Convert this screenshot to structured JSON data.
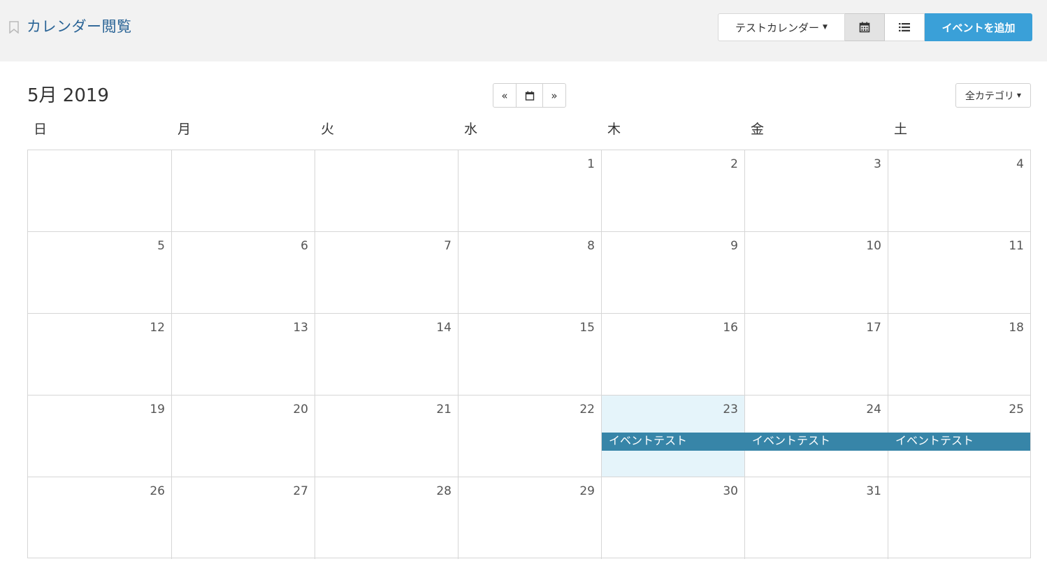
{
  "header": {
    "page_title": "カレンダー閲覧",
    "calendar_select_label": "テストカレンダー",
    "add_event_label": "イベントを追加"
  },
  "calendar": {
    "month_title": "5月 2019",
    "category_filter_label": "全カテゴリ",
    "nav": {
      "prev_label": "«",
      "next_label": "»"
    },
    "weekdays": [
      "日",
      "月",
      "火",
      "水",
      "木",
      "金",
      "土"
    ],
    "weeks": [
      [
        "",
        "",
        "",
        "1",
        "2",
        "3",
        "4"
      ],
      [
        "5",
        "6",
        "7",
        "8",
        "9",
        "10",
        "11"
      ],
      [
        "12",
        "13",
        "14",
        "15",
        "16",
        "17",
        "18"
      ],
      [
        "19",
        "20",
        "21",
        "22",
        "23",
        "24",
        "25"
      ],
      [
        "26",
        "27",
        "28",
        "29",
        "30",
        "31",
        ""
      ]
    ],
    "today": "23",
    "events": [
      {
        "title": "イベントテスト",
        "day": "23"
      },
      {
        "title": "イベントテスト",
        "day": "24"
      },
      {
        "title": "イベントテスト",
        "day": "25"
      }
    ]
  },
  "colors": {
    "accent": "#3aa0d8",
    "event": "#3785a8",
    "today_bg": "#e5f4fa",
    "title_link": "#2a6496"
  }
}
